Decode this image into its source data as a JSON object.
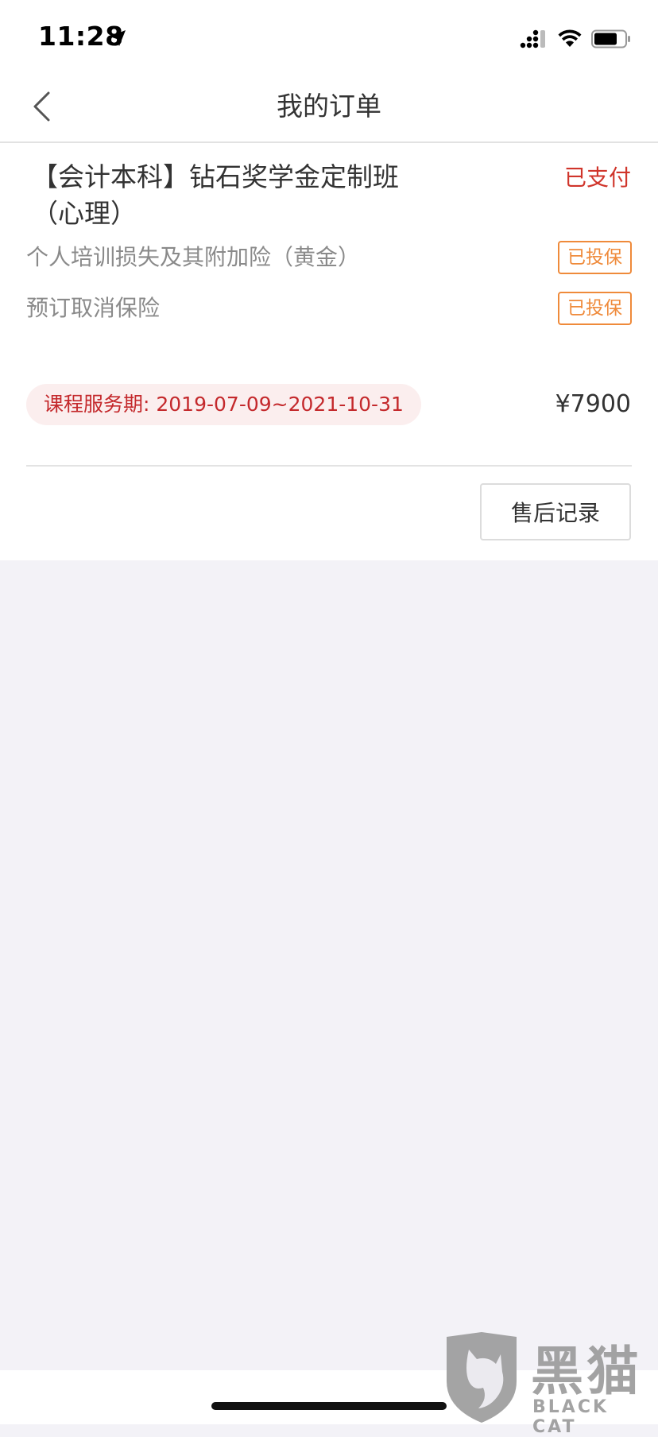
{
  "status_bar": {
    "time": "11:28"
  },
  "nav": {
    "title": "我的订单"
  },
  "order": {
    "title": "【会计本科】钻石奖学金定制班（心理）",
    "status": "已支付",
    "insurances": [
      {
        "name": "个人培训损失及其附加险（黄金）",
        "badge": "已投保"
      },
      {
        "name": "预订取消保险",
        "badge": "已投保"
      }
    ],
    "service_period": "课程服务期: 2019-07-09~2021-10-31",
    "price": "¥7900",
    "after_sale_label": "售后记录"
  },
  "watermark": {
    "cn": "黑猫",
    "en": "BLACK CAT"
  },
  "colors": {
    "status_red": "#d0352b",
    "badge_orange": "#ef8a3a",
    "pill_bg": "#fbeeee",
    "pill_text": "#c4292c",
    "page_bg": "#f3f2f7"
  }
}
